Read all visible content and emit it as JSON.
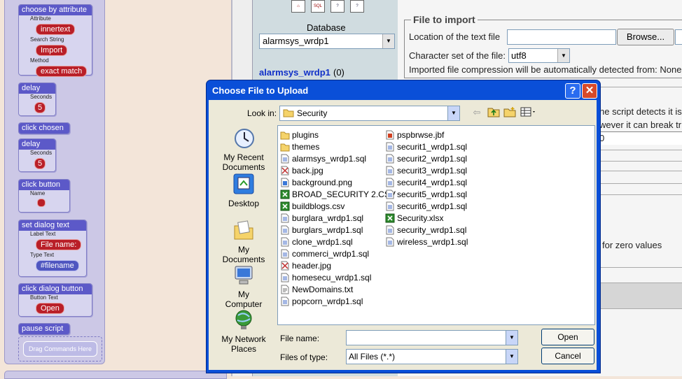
{
  "command_panel": {
    "choose_by_attribute": {
      "title": "choose by attribute",
      "attribute_label": "Attribute",
      "attribute_value": "innertext",
      "search_label": "Search String",
      "search_value": "Import",
      "method_label": "Method",
      "method_value": "exact match"
    },
    "delay_1": {
      "title": "delay",
      "seconds_label": "Seconds",
      "seconds_value": "5"
    },
    "click_chosen": {
      "title": "click chosen"
    },
    "delay_2": {
      "title": "delay",
      "seconds_label": "Seconds",
      "seconds_value": "5"
    },
    "click_button": {
      "title": "click button",
      "name_label": "Name"
    },
    "set_dialog_text": {
      "title": "set dialog text",
      "label_text_label": "Label Text",
      "label_text_value": "File name:",
      "type_text_label": "Type Text",
      "type_text_value": "#filename"
    },
    "click_dialog_button": {
      "title": "click dialog button",
      "button_text_label": "Button Text",
      "button_text_value": "Open"
    },
    "pause_script": {
      "title": "pause script"
    },
    "drag_zone": "Drag Commands Here"
  },
  "pma": {
    "nav_icons": [
      "home-icon",
      "sql-icon",
      "docs-icon",
      "query-icon"
    ],
    "nav_icon_sql_text": "SQL",
    "database_label": "Database",
    "database_selected": "alarmsys_wrdp1",
    "db_link": "alarmsys_wrdp1",
    "db_count": "(0)",
    "file_to_import_legend": "File to import",
    "location_label": "Location of the text file",
    "browse_label": "Browse...",
    "charset_label": "Character set of the file:",
    "charset_value": "utf8",
    "compression_note": "Imported file compression will be automatically detected from: None",
    "partial_text_1": "he script detects it is",
    "partial_text_2": "wever it can break tr",
    "partial_text_3": "0",
    "partial_text_4": "for zero values"
  },
  "dialog": {
    "title": "Choose File to Upload",
    "help_label": "?",
    "close_label": "✕",
    "look_in_label": "Look in:",
    "look_in_value": "Security",
    "places": [
      "My Recent Documents",
      "Desktop",
      "My Documents",
      "My Computer",
      "My Network Places"
    ],
    "files_col1": [
      {
        "name": "plugins",
        "icon": "folder-icon"
      },
      {
        "name": "themes",
        "icon": "folder-icon"
      },
      {
        "name": "alarmsys_wrdp1.sql",
        "icon": "sql-file-icon"
      },
      {
        "name": "back.jpg",
        "icon": "image-file-icon"
      },
      {
        "name": "background.png",
        "icon": "png-file-icon"
      },
      {
        "name": "BROAD_SECURITY 2.CSV",
        "icon": "excel-file-icon"
      },
      {
        "name": "buildblogs.csv",
        "icon": "excel-file-icon"
      },
      {
        "name": "burglara_wrdp1.sql",
        "icon": "sql-file-icon"
      },
      {
        "name": "burglars_wrdp1.sql",
        "icon": "sql-file-icon"
      },
      {
        "name": "clone_wrdp1.sql",
        "icon": "sql-file-icon"
      },
      {
        "name": "commerci_wrdp1.sql",
        "icon": "sql-file-icon"
      },
      {
        "name": "header.jpg",
        "icon": "image-file-icon"
      },
      {
        "name": "homesecu_wrdp1.sql",
        "icon": "sql-file-icon"
      },
      {
        "name": "NewDomains.txt",
        "icon": "text-file-icon"
      },
      {
        "name": "popcorn_wrdp1.sql",
        "icon": "sql-file-icon"
      }
    ],
    "files_col2": [
      {
        "name": "pspbrwse.jbf",
        "icon": "jbf-file-icon"
      },
      {
        "name": "securit1_wrdp1.sql",
        "icon": "sql-file-icon"
      },
      {
        "name": "securit2_wrdp1.sql",
        "icon": "sql-file-icon"
      },
      {
        "name": "securit3_wrdp1.sql",
        "icon": "sql-file-icon"
      },
      {
        "name": "securit4_wrdp1.sql",
        "icon": "sql-file-icon"
      },
      {
        "name": "securit5_wrdp1.sql",
        "icon": "sql-file-icon"
      },
      {
        "name": "securit6_wrdp1.sql",
        "icon": "sql-file-icon"
      },
      {
        "name": "Security.xlsx",
        "icon": "excel-file-icon"
      },
      {
        "name": "security_wrdp1.sql",
        "icon": "sql-file-icon"
      },
      {
        "name": "wireless_wrdp1.sql",
        "icon": "sql-file-icon"
      }
    ],
    "file_name_label": "File name:",
    "file_name_value": "",
    "files_of_type_label": "Files of type:",
    "files_of_type_value": "All Files (*.*)",
    "open_label": "Open",
    "cancel_label": "Cancel"
  }
}
